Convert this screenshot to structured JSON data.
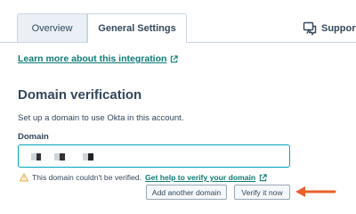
{
  "tabs": {
    "overview": "Overview",
    "general_settings": "General Settings"
  },
  "support": {
    "label": "Support r"
  },
  "learn_more": {
    "label": "Learn more about this integration"
  },
  "section": {
    "title": "Domain verification",
    "description": "Set up a domain to use Okta in this account."
  },
  "domain_field": {
    "label": "Domain"
  },
  "warning": {
    "text": "This domain couldn't be verified.",
    "help_link": "Get help to verify your domain"
  },
  "buttons": {
    "add_domain": "Add another domain",
    "verify": "Verify it now"
  },
  "colors": {
    "link": "#0b7a75",
    "input_focus_border": "#00a4bd",
    "warning": "#f5c26b",
    "arrow": "#e8602c",
    "text": "#33475b"
  },
  "icons": [
    "support-icon",
    "external-link-icon",
    "warning-icon",
    "arrow-annotation"
  ]
}
